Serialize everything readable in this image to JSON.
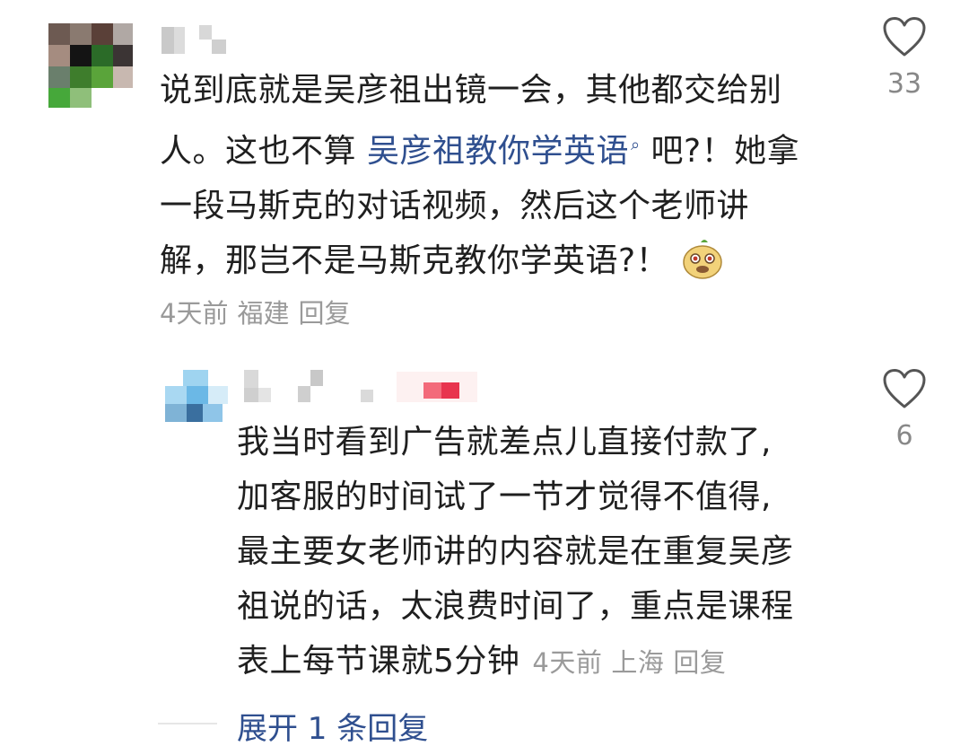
{
  "comment1": {
    "text_lines": [
      "说到底就是吴彦祖出镜一会，其他都交给别",
      "人。这也不算 ",
      "一段马斯克的对话视频，然后这个老师讲",
      "解，那岂不是马斯克教你学英语?！"
    ],
    "link_text": "吴彦祖教你学英语",
    "after_link": " 吧?！她拿",
    "meta": {
      "time": "4天前",
      "location": "福建",
      "reply": "回复"
    },
    "likes": "33"
  },
  "comment2": {
    "text_lines": [
      "我当时看到广告就差点儿直接付款了,",
      "加客服的时间试了一节才觉得不值得,",
      "最主要女老师讲的内容就是在重复吴彦",
      "祖说的话，太浪费时间了，重点是课程",
      "表上每节课就5分钟"
    ],
    "meta": {
      "time": "4天前",
      "location": "上海",
      "reply": "回复"
    },
    "likes": "6"
  },
  "expand": {
    "label": "展开 1 条回复"
  },
  "colors": {
    "link": "#2f4f8f",
    "meta": "#9a9a9a",
    "text": "#1f1f1f"
  },
  "icons": {
    "like": "heart-icon",
    "search": "search-icon",
    "emoji": "sticker-emoji-icon"
  }
}
